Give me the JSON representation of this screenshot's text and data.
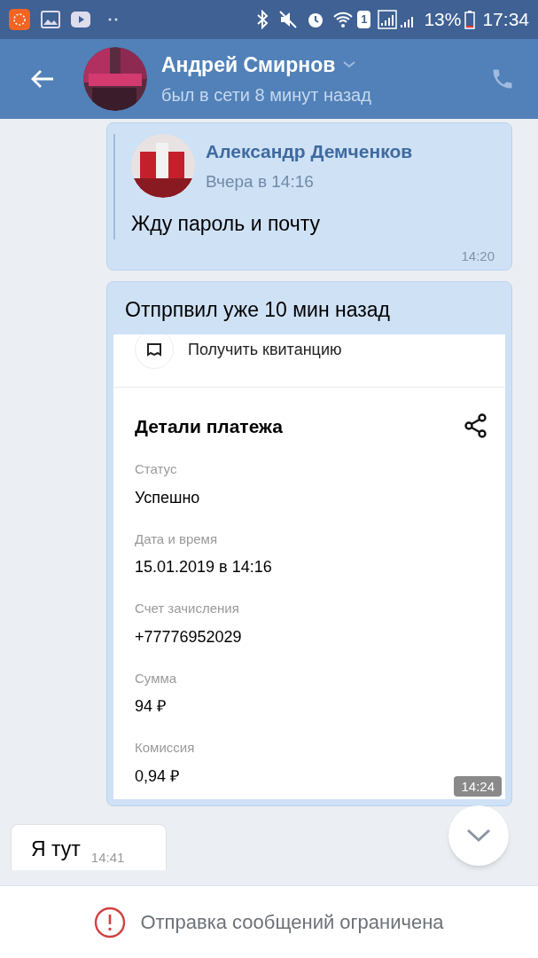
{
  "status_bar": {
    "battery": "13%",
    "time": "17:34",
    "sim": "1"
  },
  "header": {
    "name": "Андрей Смирнов",
    "status": "был в сети 8 минут назад"
  },
  "messages": [
    {
      "kind": "forward",
      "author": "Александр Демченков",
      "date": "Вчера в 14:16",
      "text": "Жду пароль и почту",
      "time": "14:20"
    },
    {
      "kind": "screenshot",
      "text": "Отпрпвил уже 10 мин назад",
      "time": "14:24",
      "shot": {
        "top_item": "Получить квитанцию",
        "title": "Детали платежа",
        "fields": [
          {
            "label": "Статус",
            "value": "Успешно"
          },
          {
            "label": "Дата и время",
            "value": "15.01.2019 в 14:16"
          },
          {
            "label": "Счет зачисления",
            "value": "+77776952029"
          },
          {
            "label": "Сумма",
            "value": "94 ₽"
          },
          {
            "label": "Комиссия",
            "value": "0,94 ₽"
          }
        ]
      }
    },
    {
      "kind": "incoming",
      "text": "Я тут",
      "time": "14:41"
    }
  ],
  "notice": "Отправка сообщений ограничена"
}
